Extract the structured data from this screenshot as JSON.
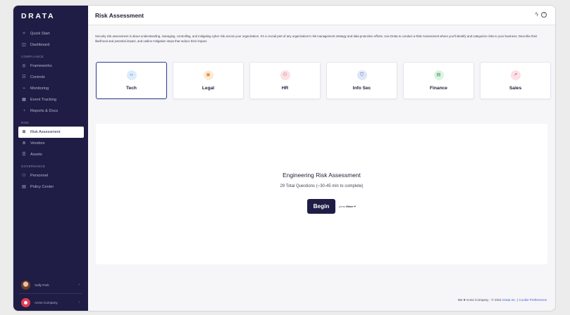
{
  "app": {
    "logo": "DRATA"
  },
  "sidebar": {
    "items_top": [
      {
        "label": "Quick Start",
        "icon": "rocket-icon"
      },
      {
        "label": "Dashboard",
        "icon": "dashboard-icon"
      }
    ],
    "sections": [
      {
        "title": "COMPLIANCE",
        "items": [
          {
            "label": "Frameworks",
            "icon": "frameworks-icon"
          },
          {
            "label": "Controls",
            "icon": "controls-icon"
          },
          {
            "label": "Monitoring",
            "icon": "monitoring-icon"
          },
          {
            "label": "Event Tracking",
            "icon": "calendar-icon"
          },
          {
            "label": "Reports & Docs",
            "icon": "reports-icon"
          }
        ]
      },
      {
        "title": "RISK",
        "items": [
          {
            "label": "Risk Assessment",
            "icon": "risk-assessment-icon",
            "active": true
          },
          {
            "label": "Vendors",
            "icon": "vendors-icon"
          },
          {
            "label": "Assets",
            "icon": "assets-icon"
          }
        ]
      },
      {
        "title": "GOVERNANCE",
        "items": [
          {
            "label": "Personnel",
            "icon": "personnel-icon"
          },
          {
            "label": "Policy Center",
            "icon": "policy-icon"
          }
        ]
      }
    ],
    "user": {
      "name": "Sally Park"
    },
    "company": {
      "name": "Acme Company"
    }
  },
  "header": {
    "title": "Risk Assessment"
  },
  "description": "Security risk assessment is about understanding, managing, controlling, and mitigating cyber risk across your organization. It's a crucial part of any organization's risk management strategy and data protection efforts. Use Drata to conduct a Risk Assessment where you'll identify and categorize risks to your business. Describe their likelihood and potential impact, and outline mitigation steps that reduce their impact.",
  "categories": [
    {
      "label": "Tech",
      "icon": "code-icon",
      "glyph": "‹›",
      "icon_bg": "#dcecfa",
      "icon_color": "#3b82c4",
      "selected": true
    },
    {
      "label": "Legal",
      "icon": "briefcase-icon",
      "glyph": "▣",
      "icon_bg": "#fdebd8",
      "icon_color": "#e08a2c"
    },
    {
      "label": "HR",
      "icon": "people-icon",
      "glyph": "⚇",
      "icon_bg": "#fbe1e3",
      "icon_color": "#d9535e"
    },
    {
      "label": "Info Sec",
      "icon": "shield-icon",
      "glyph": "⛉",
      "icon_bg": "#dfe6f8",
      "icon_color": "#3f5fc2"
    },
    {
      "label": "Finance",
      "icon": "finance-icon",
      "glyph": "▤",
      "icon_bg": "#ddf3e2",
      "icon_color": "#3a9a55"
    },
    {
      "label": "Sales",
      "icon": "trend-up-icon",
      "glyph": "↗",
      "icon_bg": "#fbe1e7",
      "icon_color": "#d6456a"
    }
  ],
  "panel": {
    "title": "Engineering Risk Assessment",
    "subtitle": "29 Total Questions (~30-45 min to complete)",
    "begin_label": "Begin",
    "hint_prefix": "press",
    "hint_key": "Enter ↵"
  },
  "footer": {
    "prefix": "We",
    "suffix": "Acme Company - © 2021",
    "link1": "Drata Inc.",
    "sep": "|",
    "link2": "Cookie Preferences"
  },
  "colors": {
    "sidebar_bg": "#1f1d45",
    "accent": "#1f1d45",
    "selected_border": "#2a3f8e"
  }
}
